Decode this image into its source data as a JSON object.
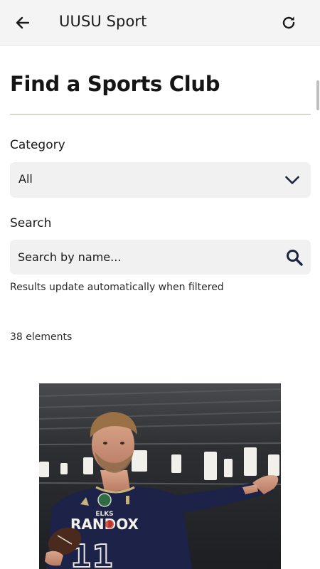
{
  "appbar": {
    "title": "UUSU Sport",
    "back_icon": "arrow-left-icon",
    "refresh_icon": "refresh-icon"
  },
  "page": {
    "heading": "Find a Sports Club"
  },
  "filters": {
    "category_label": "Category",
    "category_value": "All",
    "search_label": "Search",
    "search_placeholder": "Search by name...",
    "hint": "Results update automatically when filtered"
  },
  "results": {
    "count_text": "38 elements",
    "first_card": {
      "jersey_sponsor": "RANDOX",
      "jersey_team": "ELKS",
      "jersey_number": "11"
    }
  },
  "colors": {
    "appbar_bg": "#f4f4f4",
    "field_bg": "#f1f1f1",
    "divider": "#b8b59a",
    "icon_dark": "#1b2540"
  }
}
